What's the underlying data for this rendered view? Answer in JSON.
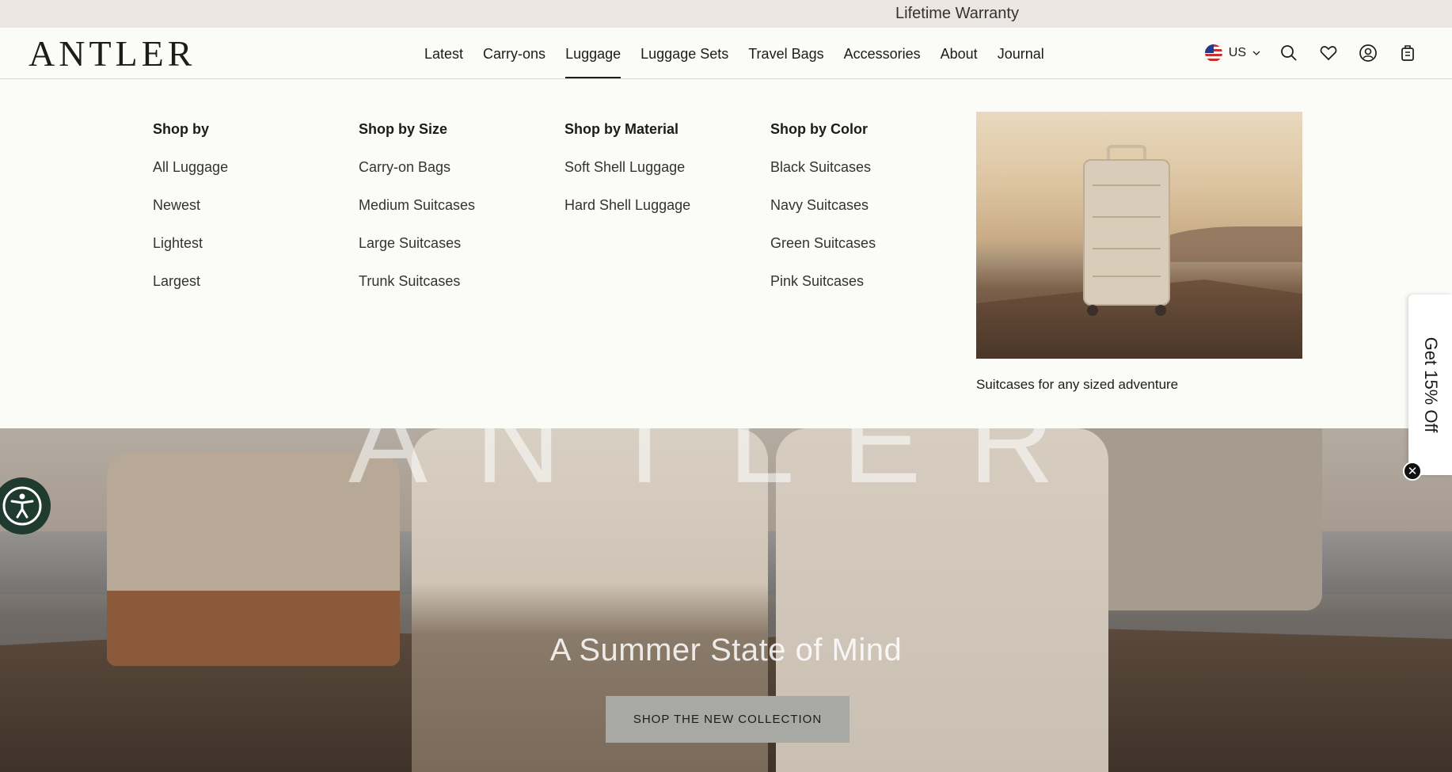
{
  "announcement": {
    "text": "Lifetime Warranty"
  },
  "header": {
    "logo": "ANTLER",
    "nav": [
      "Latest",
      "Carry-ons",
      "Luggage",
      "Luggage Sets",
      "Travel Bags",
      "Accessories",
      "About",
      "Journal"
    ],
    "active_nav": "Luggage",
    "region": "US",
    "icons": [
      "us-flag-icon",
      "chevron-down-icon",
      "search-icon",
      "heart-icon",
      "account-icon",
      "cart-icon"
    ]
  },
  "mega_menu": {
    "columns": [
      {
        "heading": "Shop by",
        "links": [
          "All Luggage",
          "Newest",
          "Lightest",
          "Largest"
        ]
      },
      {
        "heading": "Shop by Size",
        "links": [
          "Carry-on Bags",
          "Medium Suitcases",
          "Large Suitcases",
          "Trunk Suitcases"
        ]
      },
      {
        "heading": "Shop by Material",
        "links": [
          "Soft Shell Luggage",
          "Hard Shell Luggage"
        ]
      },
      {
        "heading": "Shop by Color",
        "links": [
          "Black Suitcases",
          "Navy Suitcases",
          "Green Suitcases",
          "Pink Suitcases"
        ]
      }
    ],
    "promo_caption": "Suitcases for any sized adventure"
  },
  "hero": {
    "overlay_word": "ANTLER",
    "title": "A Summer State of Mind",
    "button": "SHOP THE NEW COLLECTION"
  },
  "side_tab": {
    "label": "Get 15% Off"
  },
  "close_label": "✕",
  "colors": {
    "announcement_bg": "#ebe6e2",
    "menu_bg": "#fbfbf7",
    "a11y_bg": "#1f3a2e"
  }
}
